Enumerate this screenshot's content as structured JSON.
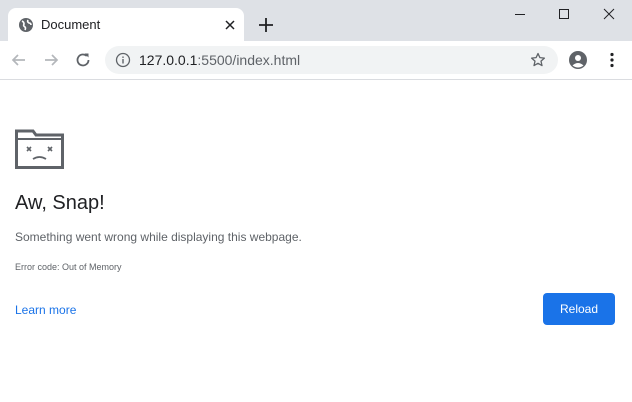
{
  "browser": {
    "tab": {
      "title": "Document",
      "favicon": "globe-icon"
    },
    "new_tab_icon": "plus-icon",
    "window_controls": [
      "minimize-icon",
      "maximize-icon",
      "close-icon"
    ],
    "toolbar": {
      "back_icon": "arrow-left-icon",
      "forward_icon": "arrow-right-icon",
      "reload_icon": "reload-icon",
      "url_host": "127.0.0.1",
      "url_rest": ":5500/index.html",
      "info_icon": "info-icon",
      "bookmark_icon": "star-icon",
      "profile_icon": "account-circle-icon",
      "menu_icon": "more-vert-icon"
    }
  },
  "error_page": {
    "icon": "sad-folder-icon",
    "title": "Aw, Snap!",
    "message": "Something went wrong while displaying this webpage.",
    "error_code": "Error code: Out of Memory",
    "learn_more_label": "Learn more",
    "reload_label": "Reload"
  },
  "colors": {
    "tabstrip_bg": "#dee1e6",
    "omnibox_bg": "#f1f3f4",
    "accent": "#1a73e8",
    "text_primary": "#202124",
    "text_secondary": "#5f6368"
  }
}
